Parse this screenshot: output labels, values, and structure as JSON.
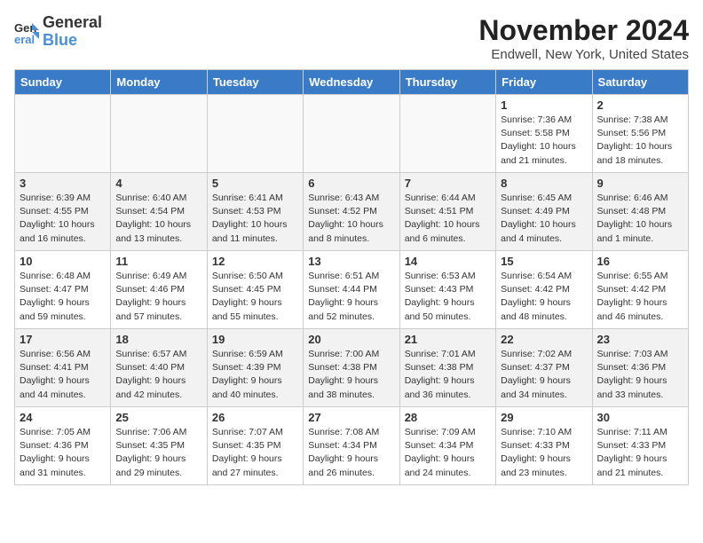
{
  "logo": {
    "line1": "General",
    "line2": "Blue"
  },
  "title": "November 2024",
  "location": "Endwell, New York, United States",
  "days_of_week": [
    "Sunday",
    "Monday",
    "Tuesday",
    "Wednesday",
    "Thursday",
    "Friday",
    "Saturday"
  ],
  "weeks": [
    [
      {
        "day": "",
        "info": ""
      },
      {
        "day": "",
        "info": ""
      },
      {
        "day": "",
        "info": ""
      },
      {
        "day": "",
        "info": ""
      },
      {
        "day": "",
        "info": ""
      },
      {
        "day": "1",
        "info": "Sunrise: 7:36 AM\nSunset: 5:58 PM\nDaylight: 10 hours and 21 minutes."
      },
      {
        "day": "2",
        "info": "Sunrise: 7:38 AM\nSunset: 5:56 PM\nDaylight: 10 hours and 18 minutes."
      }
    ],
    [
      {
        "day": "3",
        "info": "Sunrise: 6:39 AM\nSunset: 4:55 PM\nDaylight: 10 hours and 16 minutes."
      },
      {
        "day": "4",
        "info": "Sunrise: 6:40 AM\nSunset: 4:54 PM\nDaylight: 10 hours and 13 minutes."
      },
      {
        "day": "5",
        "info": "Sunrise: 6:41 AM\nSunset: 4:53 PM\nDaylight: 10 hours and 11 minutes."
      },
      {
        "day": "6",
        "info": "Sunrise: 6:43 AM\nSunset: 4:52 PM\nDaylight: 10 hours and 8 minutes."
      },
      {
        "day": "7",
        "info": "Sunrise: 6:44 AM\nSunset: 4:51 PM\nDaylight: 10 hours and 6 minutes."
      },
      {
        "day": "8",
        "info": "Sunrise: 6:45 AM\nSunset: 4:49 PM\nDaylight: 10 hours and 4 minutes."
      },
      {
        "day": "9",
        "info": "Sunrise: 6:46 AM\nSunset: 4:48 PM\nDaylight: 10 hours and 1 minute."
      }
    ],
    [
      {
        "day": "10",
        "info": "Sunrise: 6:48 AM\nSunset: 4:47 PM\nDaylight: 9 hours and 59 minutes."
      },
      {
        "day": "11",
        "info": "Sunrise: 6:49 AM\nSunset: 4:46 PM\nDaylight: 9 hours and 57 minutes."
      },
      {
        "day": "12",
        "info": "Sunrise: 6:50 AM\nSunset: 4:45 PM\nDaylight: 9 hours and 55 minutes."
      },
      {
        "day": "13",
        "info": "Sunrise: 6:51 AM\nSunset: 4:44 PM\nDaylight: 9 hours and 52 minutes."
      },
      {
        "day": "14",
        "info": "Sunrise: 6:53 AM\nSunset: 4:43 PM\nDaylight: 9 hours and 50 minutes."
      },
      {
        "day": "15",
        "info": "Sunrise: 6:54 AM\nSunset: 4:42 PM\nDaylight: 9 hours and 48 minutes."
      },
      {
        "day": "16",
        "info": "Sunrise: 6:55 AM\nSunset: 4:42 PM\nDaylight: 9 hours and 46 minutes."
      }
    ],
    [
      {
        "day": "17",
        "info": "Sunrise: 6:56 AM\nSunset: 4:41 PM\nDaylight: 9 hours and 44 minutes."
      },
      {
        "day": "18",
        "info": "Sunrise: 6:57 AM\nSunset: 4:40 PM\nDaylight: 9 hours and 42 minutes."
      },
      {
        "day": "19",
        "info": "Sunrise: 6:59 AM\nSunset: 4:39 PM\nDaylight: 9 hours and 40 minutes."
      },
      {
        "day": "20",
        "info": "Sunrise: 7:00 AM\nSunset: 4:38 PM\nDaylight: 9 hours and 38 minutes."
      },
      {
        "day": "21",
        "info": "Sunrise: 7:01 AM\nSunset: 4:38 PM\nDaylight: 9 hours and 36 minutes."
      },
      {
        "day": "22",
        "info": "Sunrise: 7:02 AM\nSunset: 4:37 PM\nDaylight: 9 hours and 34 minutes."
      },
      {
        "day": "23",
        "info": "Sunrise: 7:03 AM\nSunset: 4:36 PM\nDaylight: 9 hours and 33 minutes."
      }
    ],
    [
      {
        "day": "24",
        "info": "Sunrise: 7:05 AM\nSunset: 4:36 PM\nDaylight: 9 hours and 31 minutes."
      },
      {
        "day": "25",
        "info": "Sunrise: 7:06 AM\nSunset: 4:35 PM\nDaylight: 9 hours and 29 minutes."
      },
      {
        "day": "26",
        "info": "Sunrise: 7:07 AM\nSunset: 4:35 PM\nDaylight: 9 hours and 27 minutes."
      },
      {
        "day": "27",
        "info": "Sunrise: 7:08 AM\nSunset: 4:34 PM\nDaylight: 9 hours and 26 minutes."
      },
      {
        "day": "28",
        "info": "Sunrise: 7:09 AM\nSunset: 4:34 PM\nDaylight: 9 hours and 24 minutes."
      },
      {
        "day": "29",
        "info": "Sunrise: 7:10 AM\nSunset: 4:33 PM\nDaylight: 9 hours and 23 minutes."
      },
      {
        "day": "30",
        "info": "Sunrise: 7:11 AM\nSunset: 4:33 PM\nDaylight: 9 hours and 21 minutes."
      }
    ]
  ]
}
